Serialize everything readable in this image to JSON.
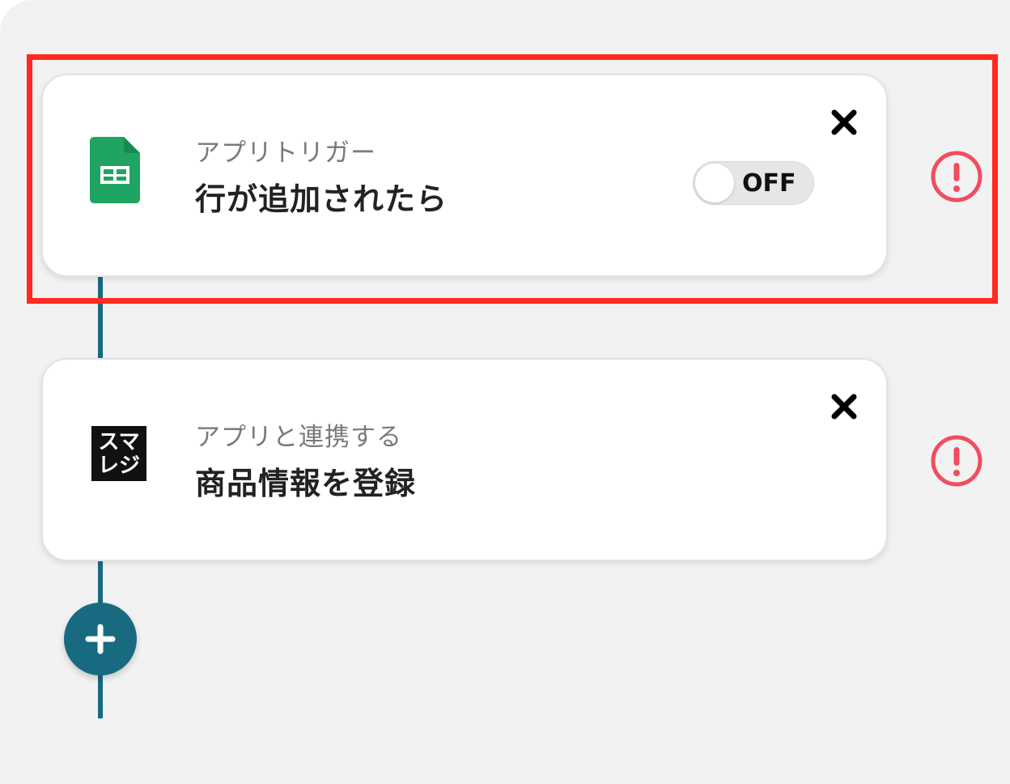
{
  "flow": {
    "steps": [
      {
        "app": "Google Sheets",
        "icon": "google-sheets-icon",
        "subtitle": "アプリトリガー",
        "title": "行が追加されたら",
        "toggle_label": "OFF",
        "has_toggle": true,
        "has_alert": true
      },
      {
        "app": "スマレジ",
        "icon": "smaregi-icon",
        "icon_text_line1": "スマ",
        "icon_text_line2": "レジ",
        "subtitle": "アプリと連携する",
        "title": "商品情報を登録",
        "has_toggle": false,
        "has_alert": true
      }
    ],
    "add_step_icon": "plus-icon"
  },
  "colors": {
    "accent": "#176a80",
    "alert": "#f24d5e",
    "highlight": "#ff2a1f",
    "sheets_green": "#1fa463",
    "panel_bg": "#f2f2f2"
  }
}
